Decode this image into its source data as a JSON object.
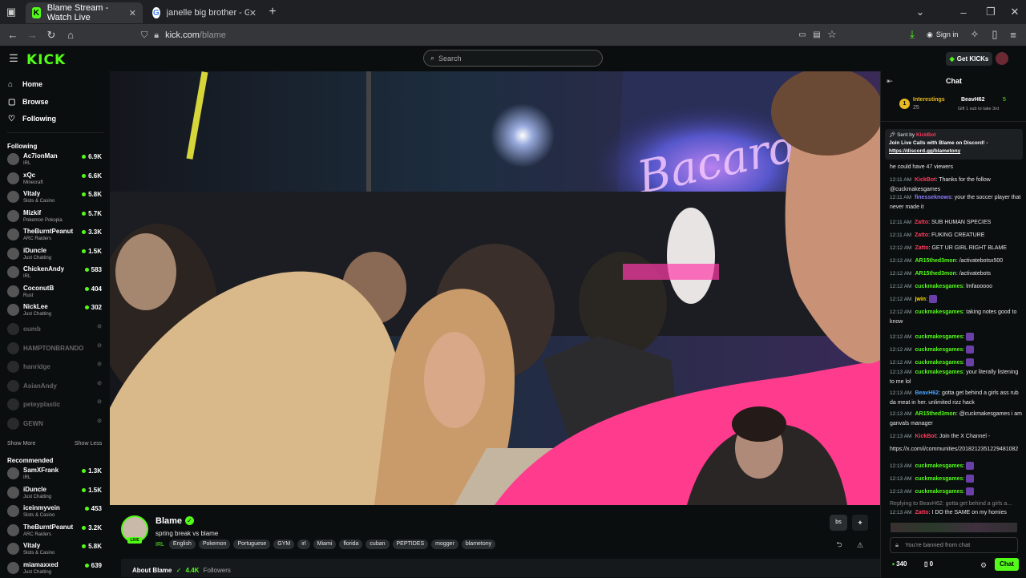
{
  "browser": {
    "tabs": [
      {
        "title": "Blame Stream - Watch Live",
        "active": true
      },
      {
        "title": "janelle big brother - Google Se",
        "active": false
      }
    ],
    "url_host": "kick.com",
    "url_path": "/blame",
    "sign_in": "Sign in"
  },
  "header": {
    "logo": "KICK",
    "search_placeholder": "Search",
    "get_kicks": "Get KICKs"
  },
  "nav": [
    {
      "label": "Home",
      "icon": "home-icon"
    },
    {
      "label": "Browse",
      "icon": "browse-icon"
    },
    {
      "label": "Following",
      "icon": "heart-icon"
    }
  ],
  "following": {
    "title": "Following",
    "channels": [
      {
        "name": "Ac7ionMan",
        "category": "IRL",
        "viewers": "6.9K"
      },
      {
        "name": "xQc",
        "category": "Minecraft",
        "viewers": "6.6K"
      },
      {
        "name": "Vitaly",
        "category": "Slots & Casino",
        "viewers": "5.8K"
      },
      {
        "name": "Mizkif",
        "category": "Pokemon Pokopia",
        "viewers": "5.7K"
      },
      {
        "name": "TheBurntPeanut",
        "category": "ARC Raiders",
        "viewers": "3.3K"
      },
      {
        "name": "iDuncle",
        "category": "Just Chatting",
        "viewers": "1.5K"
      },
      {
        "name": "ChickenAndy",
        "category": "IRL",
        "viewers": "583"
      },
      {
        "name": "CoconutB",
        "category": "Rust",
        "viewers": "404"
      },
      {
        "name": "NickLee",
        "category": "Just Chatting",
        "viewers": "302"
      }
    ],
    "offline": [
      "oumb",
      "HAMPTONBRANDO",
      "hanridge",
      "AsianAndy",
      "peteyplastic",
      "GEWN"
    ],
    "show_more": "Show More",
    "show_less": "Show Less"
  },
  "recommended": {
    "title": "Recommended",
    "channels": [
      {
        "name": "SamXFrank",
        "category": "IRL",
        "viewers": "1.3K"
      },
      {
        "name": "iDuncle",
        "category": "Just Chatting",
        "viewers": "1.5K"
      },
      {
        "name": "iceinmyvein",
        "category": "Slots & Casino",
        "viewers": "453"
      },
      {
        "name": "TheBurntPeanut",
        "category": "ARC Raiders",
        "viewers": "3.2K"
      },
      {
        "name": "Vitaly",
        "category": "Slots & Casino",
        "viewers": "5.8K"
      },
      {
        "name": "miamaxxed",
        "category": "Just Chatting",
        "viewers": "639"
      }
    ]
  },
  "stream": {
    "streamer": "Blame",
    "title": "spring break vs blame",
    "live_badge": "LIVE",
    "tags": [
      "IRL",
      "English",
      "Pokemon",
      "Portuguese",
      "GYM",
      "irl",
      "Miami",
      "florida",
      "cuban",
      "PEPTIDES",
      "mogger",
      "blametony"
    ],
    "about": "About Blame",
    "followers": "4.4K",
    "followers_label": "Followers",
    "subs_button": "bs"
  },
  "chat": {
    "title": "Chat",
    "leaderboard": [
      {
        "rank": "1",
        "name": "Interestings",
        "count": "25"
      },
      {
        "name": "BeavH62",
        "count": "5",
        "note": "Gift 1 sub to take 3rd"
      }
    ],
    "pinned": {
      "sent_by": "Sent by",
      "sender": "KickBot",
      "text": "Join Live Calls with Blame on Discord! -",
      "link": "https://discord.gg/blametony"
    },
    "messages": [
      {
        "time": "",
        "user": "",
        "text": "he could have 47 viewers",
        "color": "#e6e6e6"
      },
      {
        "time": "12:11 AM",
        "user": "KickBot",
        "text": "Thanks for the follow @cuckmakesgames",
        "color": "#ff3b5c"
      },
      {
        "time": "12:11 AM",
        "user": "finesseknows",
        "text": "your the soccer player that never made it",
        "color": "#8b7bff"
      },
      {
        "time": "12:11 AM",
        "user": "Zatto",
        "text": "SUB HUMAN SPECIES",
        "color": "#ff3b5c"
      },
      {
        "time": "12:11 AM",
        "user": "Zatto",
        "text": "FUKING CREATURE",
        "color": "#ff3b5c"
      },
      {
        "time": "12:12 AM",
        "user": "Zatto",
        "text": "GET UR GIRL RIGHT BLAME",
        "color": "#ff3b5c"
      },
      {
        "time": "12:12 AM",
        "user": "AR15thed3mon",
        "text": "/activatebotsx500",
        "color": "#53fc18"
      },
      {
        "time": "12:12 AM",
        "user": "AR15thed3mon",
        "text": "/activatebots",
        "color": "#53fc18"
      },
      {
        "time": "12:12 AM",
        "user": "cuckmakesgames",
        "text": "lmfaooooo",
        "color": "#53fc18"
      },
      {
        "time": "12:12 AM",
        "user": "jwin",
        "text": "",
        "color": "#ffd700"
      },
      {
        "time": "12:12 AM",
        "user": "cuckmakesgames",
        "text": "taking notes good to know",
        "color": "#53fc18"
      },
      {
        "time": "12:12 AM",
        "user": "cuckmakesgames",
        "text": "",
        "color": "#53fc18"
      },
      {
        "time": "12:12 AM",
        "user": "cuckmakesgames",
        "text": "",
        "color": "#53fc18"
      },
      {
        "time": "12:12 AM",
        "user": "cuckmakesgames",
        "text": "",
        "color": "#53fc18"
      },
      {
        "time": "12:13 AM",
        "user": "cuckmakesgames",
        "text": "your literally listening to me lol",
        "color": "#53fc18"
      },
      {
        "time": "12:13 AM",
        "user": "BeavH62",
        "text": "gotta get behind a girls ass rub da meat in her. unlimited rizz hack",
        "color": "#4aa3ff"
      },
      {
        "time": "12:13 AM",
        "user": "AR15thed3mon",
        "text": "@cuckmakesgames i am ganvals manager",
        "color": "#53fc18"
      },
      {
        "time": "12:13 AM",
        "user": "KickBot",
        "text": "Join the X Channel -",
        "color": "#ff3b5c"
      },
      {
        "time": "",
        "user": "",
        "text": "https://x.com/i/communities/2018212351229481082",
        "color": "#e6e6e6"
      },
      {
        "time": "12:13 AM",
        "user": "cuckmakesgames",
        "text": "",
        "color": "#53fc18"
      },
      {
        "time": "12:13 AM",
        "user": "cuckmakesgames",
        "text": "",
        "color": "#53fc18"
      },
      {
        "time": "12:13 AM",
        "user": "cuckmakesgames",
        "text": "",
        "color": "#53fc18"
      },
      {
        "time": "",
        "user": "",
        "text": "Replying to BeavH62: gotta get behind a girls a...",
        "color": "#888"
      },
      {
        "time": "12:13 AM",
        "user": "Zatto",
        "text": "I DO the SAME on my homies",
        "color": "#ff3b5c"
      }
    ],
    "banned": "You're banned from chat",
    "points": "340",
    "subs": "0",
    "chat_button": "Chat"
  },
  "colors": {
    "accent": "#53fc18",
    "bg": "#0b0e0f"
  }
}
